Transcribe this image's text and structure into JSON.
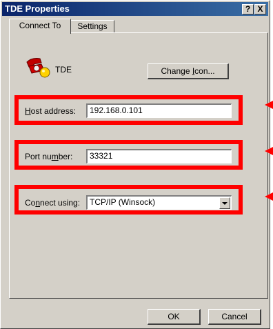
{
  "window": {
    "title": "TDE Properties",
    "help_button": "?",
    "close_button": "X"
  },
  "tabs": [
    {
      "label": "Connect To",
      "active": true
    },
    {
      "label": "Settings",
      "active": false
    }
  ],
  "connection": {
    "name": "TDE",
    "icon": "telephone-icon",
    "change_icon_button": {
      "before": "Change ",
      "accel": "I",
      "after": "con..."
    }
  },
  "fields": {
    "host_address": {
      "before": "",
      "accel": "H",
      "after": "ost address:",
      "value": "192.168.0.101"
    },
    "port_number": {
      "before": "Port nu",
      "accel": "m",
      "after": "ber:",
      "value": "33321"
    },
    "connect_using": {
      "before": "Co",
      "accel": "n",
      "after": "nect using:",
      "value": "TCP/IP (Winsock)"
    }
  },
  "buttons": {
    "ok": "OK",
    "cancel": "Cancel"
  },
  "colors": {
    "highlight": "#ff0000",
    "title_bar": "#0a246a",
    "dialog_face": "#d4d0c8"
  }
}
